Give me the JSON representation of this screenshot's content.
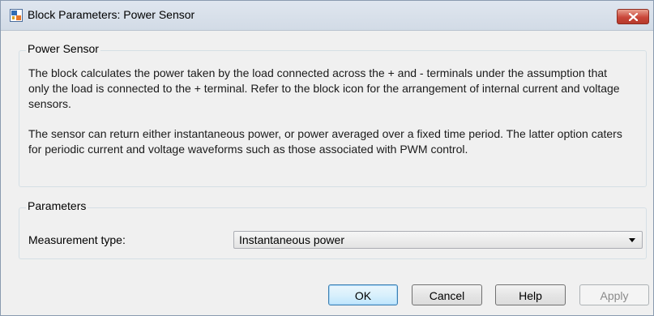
{
  "window": {
    "title": "Block Parameters: Power Sensor",
    "close_label": "close"
  },
  "block_group": {
    "label": "Power Sensor",
    "description_1": "The block calculates the power taken by the load connected across the + and - terminals under the assumption that only the load is connected to the + terminal. Refer to the block icon for the arrangement of internal current and voltage sensors.",
    "description_2": "The sensor can return either instantaneous power, or power averaged over a fixed time period. The latter option caters for periodic current and voltage waveforms such as those associated with PWM control."
  },
  "parameters_group": {
    "label": "Parameters",
    "measurement_type_label": "Measurement type:",
    "measurement_type_value": "Instantaneous power"
  },
  "buttons": {
    "ok": "OK",
    "cancel": "Cancel",
    "help": "Help",
    "apply": "Apply"
  },
  "colors": {
    "accent": "#3c7fb1",
    "close": "#c9473a",
    "window_bg": "#f0f0f0"
  },
  "icons": {
    "title": "simulink-block-icon",
    "close": "close-icon",
    "dropdown": "chevron-down-icon"
  }
}
